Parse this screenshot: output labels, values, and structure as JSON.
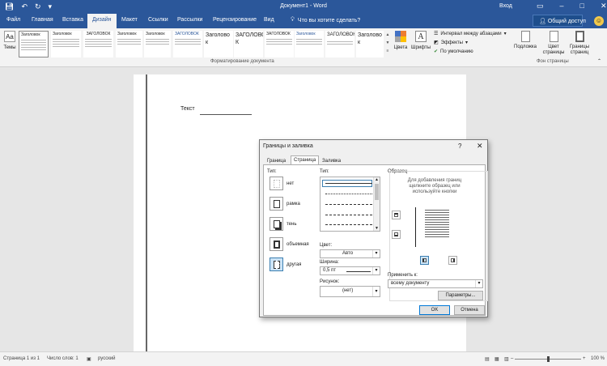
{
  "window": {
    "title": "Документ1 - Word",
    "sign_in": "Вход"
  },
  "tabs": [
    {
      "label": "Файл"
    },
    {
      "label": "Главная"
    },
    {
      "label": "Вставка"
    },
    {
      "label": "Дизайн"
    },
    {
      "label": "Макет"
    },
    {
      "label": "Ссылки"
    },
    {
      "label": "Рассылки"
    },
    {
      "label": "Рецензирование"
    },
    {
      "label": "Вид"
    }
  ],
  "tell_me": {
    "placeholder": "Что вы хотите сделать?"
  },
  "share_label": "Общий доступ",
  "ribbon": {
    "themes_label": "Темы",
    "style_thumbs": [
      {
        "title": "Заголовок"
      },
      {
        "title": "Заголовок"
      },
      {
        "title": "ЗАГОЛОВОК"
      },
      {
        "title": "Заголовок"
      },
      {
        "title": "Заголовок"
      },
      {
        "title": "ЗАГОЛОВОК"
      },
      {
        "title": "ЗАГОЛОВОК"
      },
      {
        "title": "Заголовок"
      }
    ],
    "big_thumbs": [
      {
        "text": "Заголово к"
      },
      {
        "text": "ЗАГОЛОВО К"
      },
      {
        "text": "ЗАГОЛОВОК"
      },
      {
        "text": "Заголово к"
      }
    ],
    "colors_label": "Цвета",
    "fonts_label": "Шрифты",
    "paragraph_spacing": "Интервал между абзацами",
    "effects": "Эффекты",
    "set_default": "По умолчанию",
    "group_doc_format": "Форматирование документа",
    "watermark": "Подложка",
    "page_color": "Цвет страницы",
    "page_borders": "Границы страниц",
    "group_page_bg": "Фон страницы"
  },
  "document": {
    "text": "Текст"
  },
  "dialog": {
    "title": "Границы и заливка",
    "help": "?",
    "tabs": [
      {
        "label": "Граница"
      },
      {
        "label": "Страница"
      },
      {
        "label": "Заливка"
      }
    ],
    "type_label": "Тип:",
    "settings": [
      {
        "label": "нет"
      },
      {
        "label": "рамка"
      },
      {
        "label": "тень"
      },
      {
        "label": "объемная"
      },
      {
        "label": "другая"
      }
    ],
    "style_label": "Тип:",
    "color_label": "Цвет:",
    "color_value": "Авто",
    "width_label": "Ширина:",
    "width_value": "0,5 пт",
    "art_label": "Рисунок:",
    "art_value": "(нет)",
    "preview_label": "Образец",
    "preview_hint": "Для добавления границ щелкните образец или используйте кнопки",
    "apply_label": "Применить к:",
    "apply_value": "всему документу",
    "options_button": "Параметры...",
    "ok_button": "OK",
    "cancel_button": "Отмена"
  },
  "status": {
    "page": "Страница 1 из 1",
    "words": "Число слов: 1",
    "language": "русский",
    "zoom": "100 %"
  }
}
